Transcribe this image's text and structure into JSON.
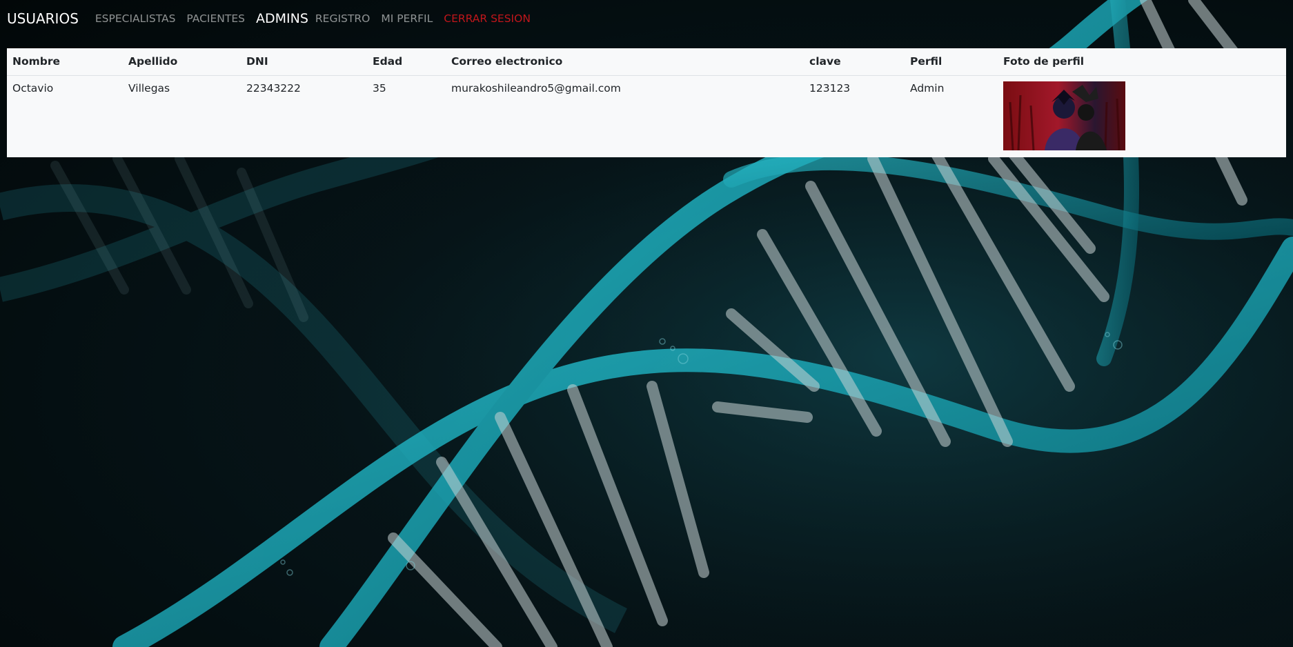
{
  "nav": {
    "brand": "USUARIOS",
    "links": [
      {
        "label": "ESPECIALISTAS",
        "active": false
      },
      {
        "label": "PACIENTES",
        "active": false
      },
      {
        "label": "ADMINS",
        "active": true
      },
      {
        "label": "REGISTRO",
        "active": false
      },
      {
        "label": "MI PERFIL",
        "active": false
      },
      {
        "label": "CERRAR SESION",
        "active": false
      }
    ]
  },
  "table": {
    "headers": [
      "Nombre",
      "Apellido",
      "DNI",
      "Edad",
      "Correo electronico",
      "clave",
      "Perfil",
      "Foto de perfil"
    ],
    "rows": [
      {
        "nombre": "Octavio",
        "apellido": "Villegas",
        "dni": "22343222",
        "edad": "35",
        "correo": "murakoshileandro5@gmail.com",
        "clave": "123123",
        "perfil": "Admin",
        "foto": "profile-photo-anime-character"
      }
    ]
  },
  "colors": {
    "danger": "#c0161b",
    "panel": "#f8f9fa",
    "dna": "#1fb3c4"
  }
}
